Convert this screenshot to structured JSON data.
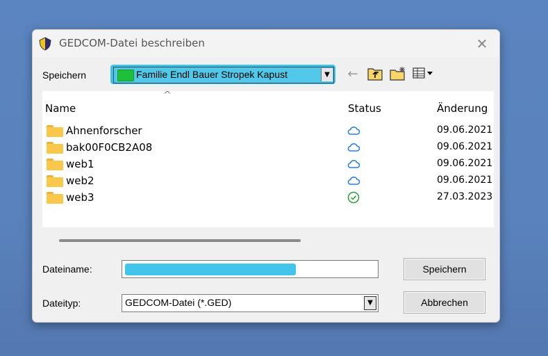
{
  "dialog": {
    "title": "GEDCOM-Datei beschreiben",
    "close_glyph": "✕"
  },
  "toolbar": {
    "save_in_label": "Speichern",
    "location": "Familie Endl Bauer Stropek Kapust",
    "dropdown_glyph": "▼",
    "back_glyph": "←",
    "icons": [
      "back-icon",
      "up-folder-icon",
      "new-folder-icon",
      "view-menu-icon"
    ]
  },
  "file_list": {
    "sort_glyph": "^",
    "columns": {
      "name": "Name",
      "status": "Status",
      "date": "Änderung"
    },
    "rows": [
      {
        "name": "Ahnenforscher",
        "status": "cloud",
        "date": "09.06.2021"
      },
      {
        "name": "bak00F0CB2A08",
        "status": "cloud",
        "date": "09.06.2021"
      },
      {
        "name": "web1",
        "status": "cloud",
        "date": "09.06.2021"
      },
      {
        "name": "web2",
        "status": "cloud",
        "date": "09.06.2021"
      },
      {
        "name": "web3",
        "status": "synced",
        "date": "27.03.2023"
      }
    ]
  },
  "form": {
    "filename_label": "Dateiname:",
    "filename_value": "",
    "filetype_label": "Dateityp:",
    "filetype_value": "GEDCOM-Datei (*.GED)",
    "save_button": "Speichern",
    "cancel_button": "Abbrechen"
  },
  "colors": {
    "desktop": "#5b85c0",
    "highlight": "#3fc1e8",
    "cloud": "#2f7fd0",
    "synced": "#2e9b3a"
  }
}
